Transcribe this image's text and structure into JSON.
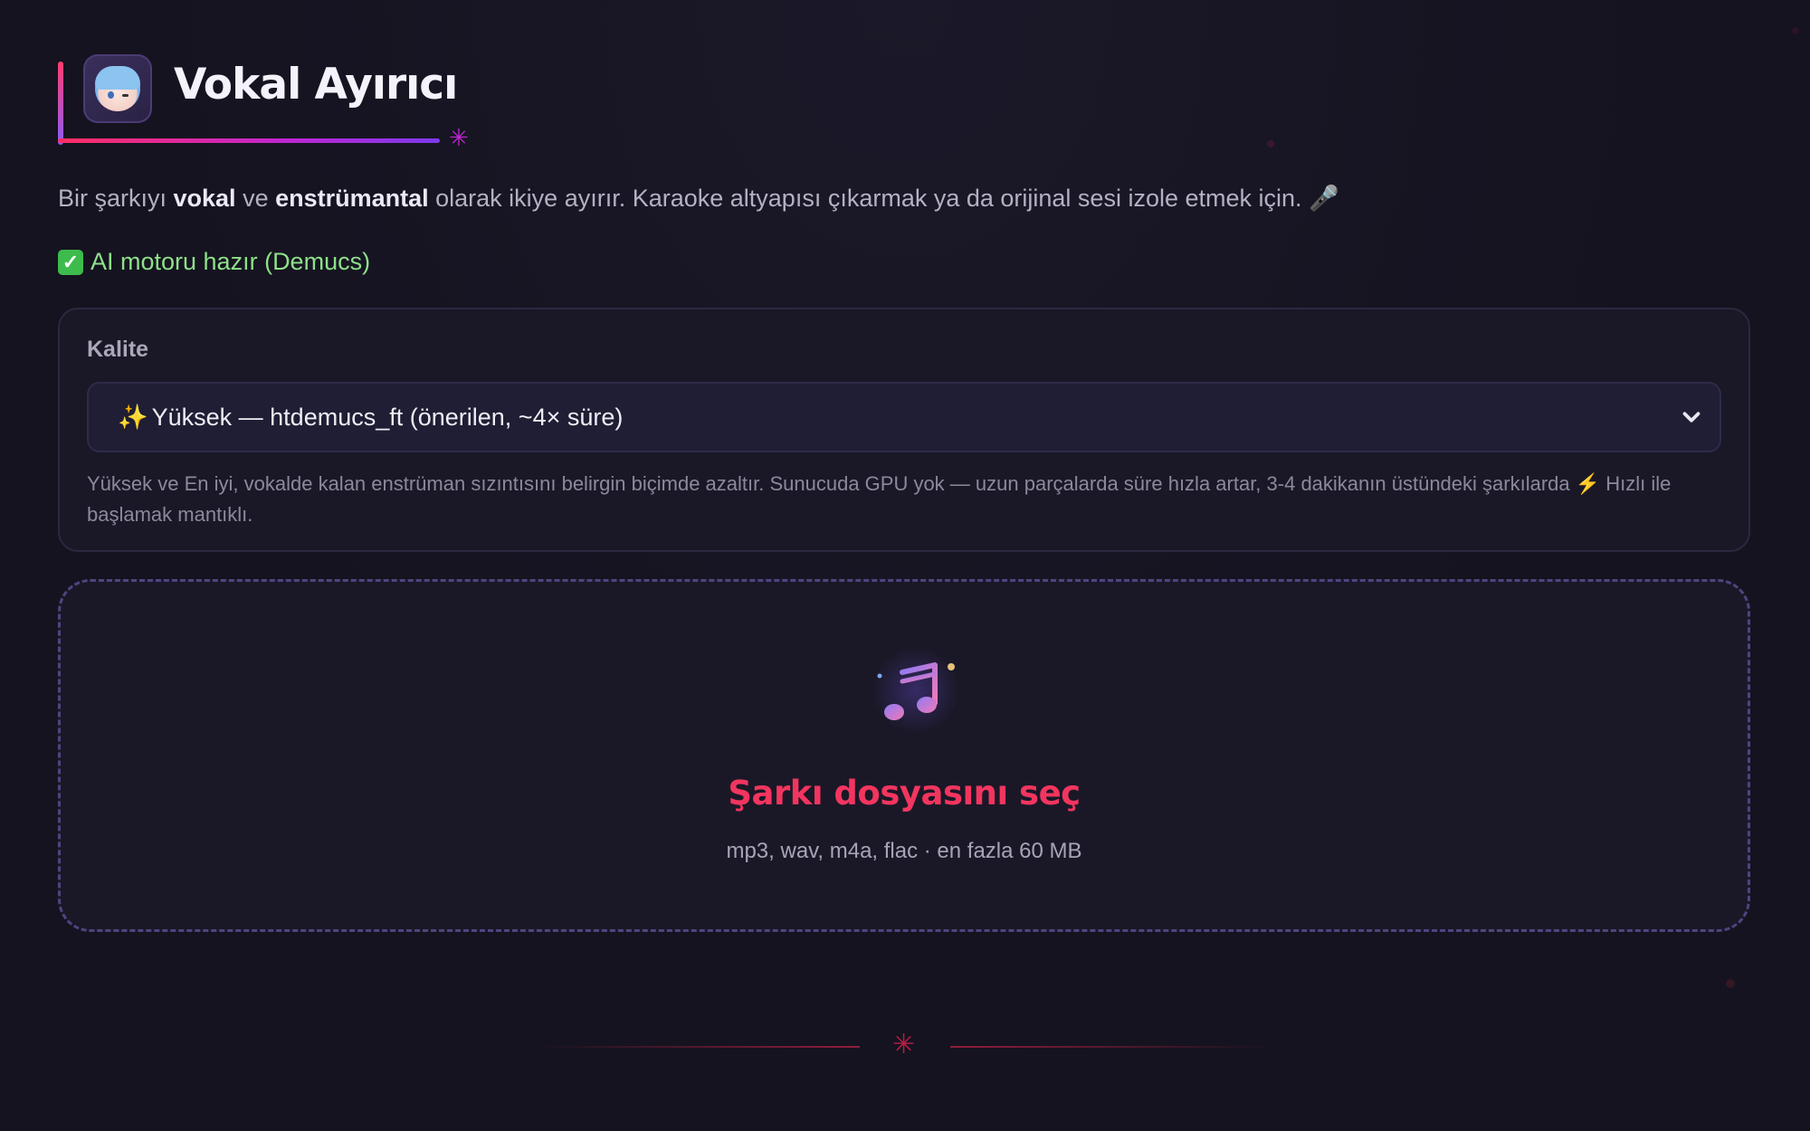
{
  "app": {
    "title": "Vokal Ayırıcı",
    "avatar_icon": "anime-avatar-icon"
  },
  "description": {
    "part1": "Bir şarkıyı ",
    "bold1": "vokal",
    "part2": " ve ",
    "bold2": "enstrümantal",
    "part3": " olarak ikiye ayırır. Karaoke altyapısı çıkarmak ya da orijinal sesi izole etmek için. 🎤"
  },
  "status": {
    "icon": "check-icon",
    "text": "AI motoru hazır (Demucs)"
  },
  "quality": {
    "label": "Kalite",
    "selected": "Yüksek — htdemucs_ft (önerilen, ~4× süre)",
    "hint_part1": "Yüksek ve En iyi, vokalde kalan enstrüman sızıntısını belirgin biçimde azaltır. Sunucuda GPU yok — uzun parçalarda süre hızla artar, 3-4 dakikanın üstündeki şarkılarda ",
    "hint_part2": " Hızlı ile başlamak mantıklı."
  },
  "upload": {
    "title": "Şarkı dosyasını seç",
    "subtitle": "mp3, wav, m4a, flac · en fazla 60 MB",
    "icon": "music-note-icon"
  },
  "colors": {
    "accent": "#f2355f",
    "status_ok": "#8ee08a",
    "background": "#15131f"
  }
}
